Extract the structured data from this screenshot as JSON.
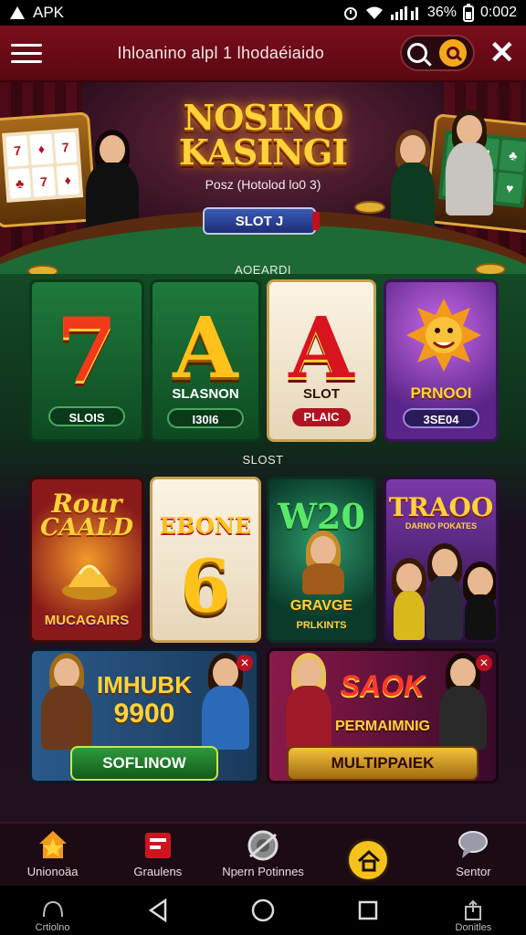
{
  "status_bar": {
    "app_label": "APK",
    "battery": "36%",
    "time": "0:002"
  },
  "app_bar": {
    "title": "Ihloanino alpl 1 lhodaéiaido"
  },
  "hero": {
    "title_line1": "NOSINO",
    "title_line2": "KASINGI",
    "subtitle": "Posz (Hotolod lo0 3)",
    "tab_label": "SLOT J"
  },
  "sections": {
    "top_label": "AOEARDI",
    "mid_label": "SLOST"
  },
  "row1": [
    {
      "glyph": "7",
      "caption": "",
      "pill": "SLOIS",
      "theme": "green"
    },
    {
      "glyph": "A",
      "caption": "SLASNON",
      "pill": "I30I6",
      "theme": "green"
    },
    {
      "glyph": "A",
      "caption": "SLOT",
      "pill": "PLAIC",
      "theme": "white"
    },
    {
      "glyph": "",
      "caption": "PRNOOI",
      "pill": "3SE04",
      "theme": "purple"
    }
  ],
  "row2": [
    {
      "top": "Rour",
      "top2": "CAALD",
      "bottom": "MUCAGAIRS",
      "theme": "fire"
    },
    {
      "top": "EBONE",
      "glyph": "6",
      "theme": "cream"
    },
    {
      "top": "W20",
      "bottom": "GRAVGE",
      "bottom2": "PRLKINTS",
      "theme": "teal"
    },
    {
      "top": "TRAOO",
      "top2": "DARNO POKATES",
      "theme": "purple"
    }
  ],
  "banners": [
    {
      "headline": "IMHUBK",
      "amount": "9900",
      "button": "SOFLINOW",
      "theme": "blue"
    },
    {
      "headline": "SAOK",
      "sub": "PERMAIMNIG",
      "button": "MULTIPPAIEK",
      "theme": "red"
    }
  ],
  "bottom_nav": [
    {
      "label": "Unionoäa",
      "icon": "star-house-icon"
    },
    {
      "label": "Graulens",
      "icon": "gift-box-icon"
    },
    {
      "label": "Npern Potinnes",
      "icon": "chip-icon"
    },
    {
      "label": "",
      "icon": "home-icon"
    },
    {
      "label": "Sentor",
      "icon": "chat-bubble-icon"
    }
  ],
  "system_nav": {
    "left_label": "Crtiolno",
    "right_label": "Donitles"
  },
  "colors": {
    "app_bar": "#6a0a16",
    "gold": "#ffd23a",
    "felt": "#1d6a34",
    "fab": "#f4c21a"
  }
}
